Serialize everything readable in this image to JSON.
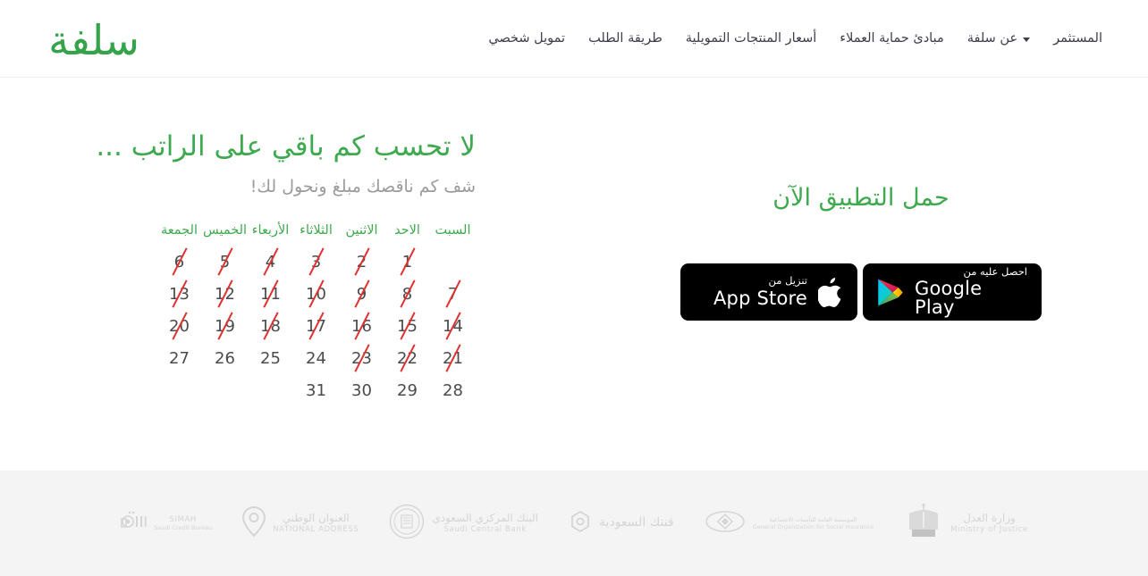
{
  "navbar": {
    "logo_text": "سلفة",
    "logo_color": "#35a349",
    "items": [
      {
        "label": "تمويل شخصي",
        "has_dropdown": false
      },
      {
        "label": "طريقة الطلب",
        "has_dropdown": false
      },
      {
        "label": "أسعار المنتجات التمويلية",
        "has_dropdown": false
      },
      {
        "label": "مبادئ حماية العملاء",
        "has_dropdown": false
      },
      {
        "label": "عن سلفة",
        "has_dropdown": true
      },
      {
        "label": "المستثمر",
        "has_dropdown": false
      }
    ]
  },
  "hero": {
    "title": "لا تحسب كم باقي على الراتب ...",
    "subtitle": "شف كم ناقصك مبلغ ونحول لك!",
    "title_color": "#3fa94f",
    "subtitle_color": "#9b9b9b"
  },
  "calendar": {
    "day_headers": [
      "الجمعة",
      "الخميس",
      "الأربعاء",
      "الثلاثاء",
      "الاثنين",
      "الاحد",
      "السبت"
    ],
    "header_color": "#3fa94f",
    "strike_color": "#e03030",
    "rows": [
      [
        {
          "day": "6",
          "struck": true
        },
        {
          "day": "5",
          "struck": true
        },
        {
          "day": "4",
          "struck": true
        },
        {
          "day": "3",
          "struck": true
        },
        {
          "day": "2",
          "struck": true
        },
        {
          "day": "1",
          "struck": true
        },
        {
          "day": "",
          "struck": false
        }
      ],
      [
        {
          "day": "13",
          "struck": true
        },
        {
          "day": "12",
          "struck": true
        },
        {
          "day": "11",
          "struck": true
        },
        {
          "day": "10",
          "struck": true
        },
        {
          "day": "9",
          "struck": true
        },
        {
          "day": "8",
          "struck": true
        },
        {
          "day": "7",
          "struck": true
        }
      ],
      [
        {
          "day": "20",
          "struck": true
        },
        {
          "day": "19",
          "struck": true
        },
        {
          "day": "18",
          "struck": true
        },
        {
          "day": "17",
          "struck": true
        },
        {
          "day": "16",
          "struck": true
        },
        {
          "day": "15",
          "struck": true
        },
        {
          "day": "14",
          "struck": true
        }
      ],
      [
        {
          "day": "27",
          "struck": false
        },
        {
          "day": "26",
          "struck": false
        },
        {
          "day": "25",
          "struck": false
        },
        {
          "day": "24",
          "struck": false
        },
        {
          "day": "23",
          "struck": true
        },
        {
          "day": "22",
          "struck": true
        },
        {
          "day": "21",
          "struck": true
        }
      ],
      [
        {
          "day": "",
          "struck": false
        },
        {
          "day": "",
          "struck": false
        },
        {
          "day": "",
          "struck": false
        },
        {
          "day": "31",
          "struck": false
        },
        {
          "day": "30",
          "struck": false
        },
        {
          "day": "29",
          "struck": false
        },
        {
          "day": "28",
          "struck": false
        }
      ]
    ]
  },
  "app_download": {
    "title": "حمل التطبيق الآن",
    "title_color": "#3fa94f",
    "google_play": {
      "small_label": "احصل عليه من",
      "big_label": "Google Play"
    },
    "app_store": {
      "small_label": "تنزيل من",
      "big_label": "App Store"
    }
  },
  "footer": {
    "partners": [
      {
        "ar": "سمة",
        "en": "SIMAH",
        "en2": "Saudi Credit Bureau"
      },
      {
        "ar": "العنوان الوطني",
        "en": "NATIONAL ADDRESS",
        "en2": ""
      },
      {
        "ar": "البنك المركزي السعودي",
        "en": "Saudi Central Bank",
        "en2": ""
      },
      {
        "ar": "فنتك السعودية",
        "en": "",
        "en2": ""
      },
      {
        "ar": "المؤسسة العامة للتأمينات الاجتماعية",
        "en": "General Organization for Social Insurance",
        "en2": ""
      },
      {
        "ar": "وزارة العدل",
        "en": "Ministry of Justice",
        "en2": ""
      }
    ]
  }
}
